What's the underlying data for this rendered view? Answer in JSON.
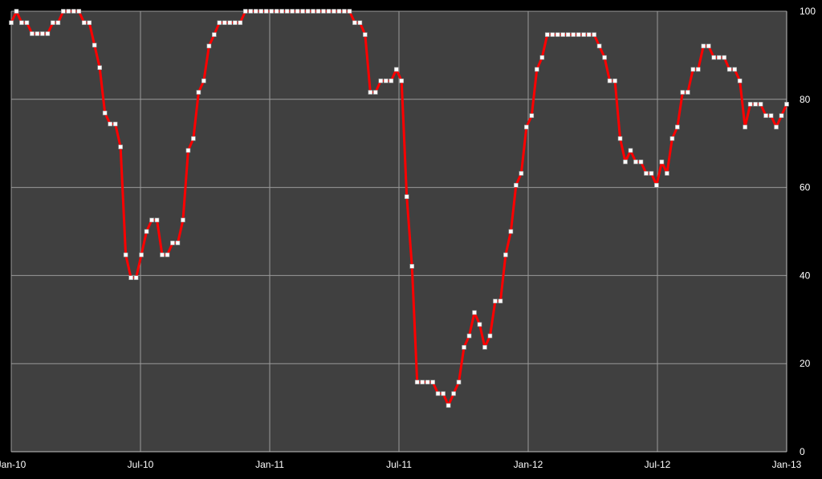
{
  "chart_data": {
    "type": "line",
    "title": "",
    "xlabel": "",
    "ylabel": "",
    "x_tick_labels": [
      "Jan-10",
      "Jul-10",
      "Jan-11",
      "Jul-11",
      "Jan-12",
      "Jul-12",
      "Jan-13"
    ],
    "y_tick_labels": [
      "0",
      "20",
      "40",
      "60",
      "80",
      "100"
    ],
    "ylim": [
      0,
      100
    ],
    "grid": true,
    "y_axis_side": "right",
    "plot_background": "#404040",
    "page_background": "#000000",
    "grid_color": "#9a9a9a",
    "series": [
      {
        "color": "#ff0000",
        "marker_color": "#ffffff",
        "values": [
          97.4,
          100,
          97.4,
          97.4,
          94.9,
          94.9,
          94.9,
          94.9,
          97.4,
          97.4,
          100,
          100,
          100,
          100,
          97.4,
          97.4,
          92.3,
          87.2,
          76.9,
          74.4,
          74.4,
          69.2,
          44.7,
          39.5,
          39.5,
          44.7,
          50.0,
          52.6,
          52.6,
          44.7,
          44.7,
          47.4,
          47.4,
          52.6,
          68.4,
          71.1,
          81.6,
          84.2,
          92.1,
          94.7,
          97.4,
          97.4,
          97.4,
          97.4,
          97.4,
          100,
          100,
          100,
          100,
          100,
          100,
          100,
          100,
          100,
          100,
          100,
          100,
          100,
          100,
          100,
          100,
          100,
          100,
          100,
          100,
          100,
          97.4,
          97.4,
          94.7,
          81.6,
          81.6,
          84.2,
          84.2,
          84.2,
          86.8,
          84.2,
          57.9,
          42.1,
          15.8,
          15.8,
          15.8,
          15.8,
          13.2,
          13.2,
          10.5,
          13.2,
          15.8,
          23.7,
          26.3,
          31.6,
          28.9,
          23.7,
          26.3,
          34.2,
          34.2,
          44.7,
          50.0,
          60.5,
          63.2,
          73.7,
          76.3,
          86.8,
          89.5,
          94.7,
          94.7,
          94.7,
          94.7,
          94.7,
          94.7,
          94.7,
          94.7,
          94.7,
          94.7,
          92.1,
          89.5,
          84.2,
          84.2,
          71.1,
          65.8,
          68.4,
          65.8,
          65.8,
          63.2,
          63.2,
          60.5,
          65.8,
          63.2,
          71.1,
          73.7,
          81.6,
          81.6,
          86.8,
          86.8,
          92.1,
          92.1,
          89.5,
          89.5,
          89.5,
          86.8,
          86.8,
          84.2,
          73.7,
          78.9,
          78.9,
          78.9,
          76.3,
          76.3,
          73.7,
          76.3,
          78.9
        ]
      }
    ]
  }
}
